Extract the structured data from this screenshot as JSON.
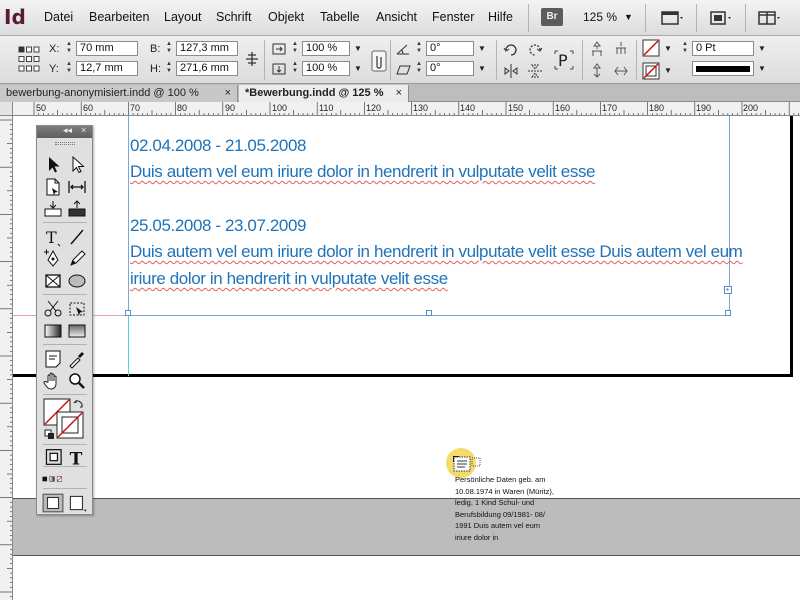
{
  "app": {
    "logo": "Id",
    "menu": [
      "Datei",
      "Bearbeiten",
      "Layout",
      "Schrift",
      "Objekt",
      "Tabelle",
      "Ansicht",
      "Fenster",
      "Hilfe"
    ],
    "bridge_label": "Br",
    "zoom": "125 %"
  },
  "control": {
    "x_label": "X:",
    "x_value": "70 mm",
    "y_label": "Y:",
    "y_value": "12,7 mm",
    "w_label": "B:",
    "w_value": "127,3 mm",
    "h_label": "H:",
    "h_value": "271,6 mm",
    "scale_x": "100 %",
    "scale_y": "100 %",
    "rotate": "0°",
    "shear": "0°",
    "stroke_weight": "0 Pt"
  },
  "tabs": [
    {
      "label": "bewerbung-anonymisiert.indd @ 100 %",
      "close": "×"
    },
    {
      "label": "*Bewerbung.indd @ 125 %",
      "close": "×"
    }
  ],
  "ruler": {
    "h_labels": [
      "50",
      "60",
      "70",
      "80",
      "90",
      "100",
      "110",
      "120",
      "130",
      "140",
      "150",
      "160",
      "170",
      "180",
      "190",
      "200"
    ]
  },
  "document": {
    "entries": [
      {
        "date": "02.04.2008 - 21.05.2008",
        "lines": [
          "Duis autem vel eum iriure dolor in hendrerit in vulputate velit esse"
        ]
      },
      {
        "date": "25.05.2008 - 23.07.2009",
        "lines": [
          "Duis autem vel eum iriure dolor in hendrerit in vulputate velit esse Duis autem vel eum",
          "iriure dolor in hendrerit in vulputate velit esse"
        ]
      }
    ],
    "small_text": [
      "Persönliche Daten geb. am",
      "10.08.1974 in Waren (Müritz),",
      "ledig, 1 Kind Schul- und",
      "Berufsbildung 09/1981- 08/",
      "1991 Duis autem vel eum",
      "iriure dolor in"
    ]
  },
  "tools_panel": {
    "collapse": "◂◂",
    "close": "×"
  },
  "colors": {
    "text_blue": "#1f73b8",
    "frame_blue": "#7aa7d6",
    "halo": "#f2d650"
  }
}
